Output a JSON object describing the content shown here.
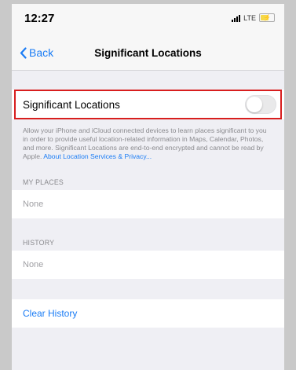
{
  "status_bar": {
    "time": "12:27",
    "network": "LTE"
  },
  "nav": {
    "back_label": "Back",
    "title": "Significant Locations"
  },
  "toggle": {
    "label": "Significant Locations",
    "on": false
  },
  "description": {
    "text": "Allow your iPhone and iCloud connected devices to learn places significant to you in order to provide useful location-related information in Maps, Calendar, Photos, and more. Significant Locations are end-to-end encrypted and cannot be read by Apple.",
    "link": "About Location Services & Privacy..."
  },
  "my_places": {
    "header": "MY PLACES",
    "value": "None"
  },
  "history": {
    "header": "HISTORY",
    "value": "None"
  },
  "clear_history_label": "Clear History",
  "colors": {
    "accent": "#1a7cf5",
    "highlight": "#d81e1e"
  }
}
